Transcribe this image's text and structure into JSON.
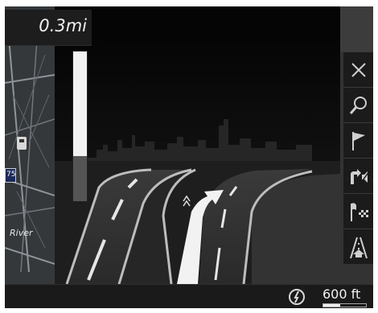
{
  "guidance": {
    "distance_to_turn": "0.3mi",
    "approach_progress_remaining": 0.7
  },
  "map": {
    "road_label": "River",
    "route_shield": "75",
    "poi_icon": "fuel-pump-icon"
  },
  "side_menu": {
    "buttons": [
      {
        "icon": "close-icon"
      },
      {
        "icon": "search-icon"
      },
      {
        "icon": "flag-icon"
      },
      {
        "icon": "mute-guidance-icon"
      },
      {
        "icon": "destination-flag-icon"
      },
      {
        "icon": "lane-guidance-icon"
      }
    ]
  },
  "status_bar": {
    "compass_icon": "compass-icon",
    "map_scale": "600 ft"
  },
  "colors": {
    "background": "#050505",
    "panel": "#1b1b1b",
    "text": "#f0f0f0",
    "route_arrow": "#f2f2f2"
  }
}
